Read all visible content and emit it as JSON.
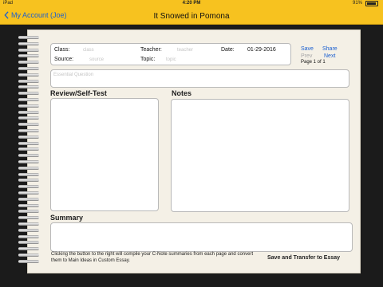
{
  "status_bar": {
    "carrier": "iPad",
    "time": "4:20 PM",
    "battery": "91%"
  },
  "nav": {
    "back_label": "My Account (Joe)",
    "title": "It Snowed in Pomona"
  },
  "form": {
    "class_label": "Class:",
    "class_placeholder": "class",
    "teacher_label": "Teacher:",
    "teacher_placeholder": "teacher",
    "date_label": "Date:",
    "date_value": "01-29-2016",
    "source_label": "Source:",
    "source_placeholder": "source",
    "topic_label": "Topic:",
    "topic_placeholder": "topic"
  },
  "actions": {
    "save": "Save",
    "share": "Share",
    "prev": "Prev",
    "next": "Next",
    "page_indicator": "Page 1 of 1"
  },
  "essential_question": {
    "placeholder": "Essential Question"
  },
  "sections": {
    "review_heading": "Review/Self-Test",
    "notes_heading": "Notes",
    "summary_heading": "Summary"
  },
  "footer": {
    "note": "Clicking the button to the right will compile your C-Note summaries from each page and convert them to Main Ideas in Custom Essay.",
    "transfer_button": "Save and Transfer to Essay"
  },
  "colors": {
    "accent_bar": "#f7c21f",
    "link": "#1a5fd0",
    "paper": "#f4f0e6"
  },
  "icons": [
    "back-chevron-icon",
    "battery-icon"
  ]
}
